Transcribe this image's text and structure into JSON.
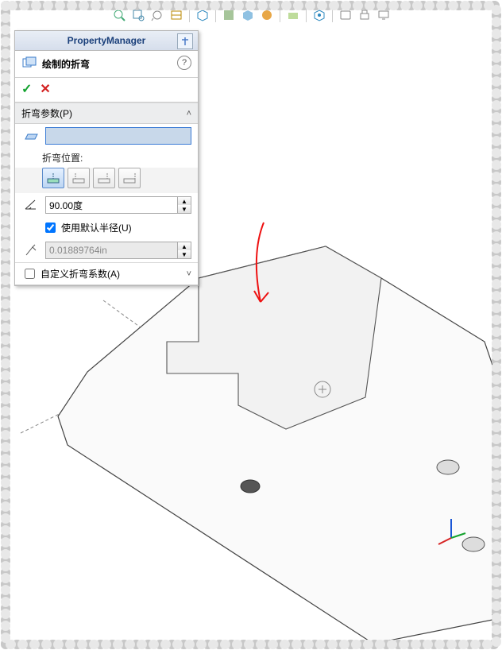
{
  "panel": {
    "title": "PropertyManager",
    "feature": {
      "label": "绘制的折弯",
      "help": "?"
    },
    "confirm_ok": "✓",
    "confirm_cancel": "✕",
    "section_params": {
      "title": "折弯参数(P)"
    },
    "bend_position_label": "折弯位置:",
    "angle": {
      "value": "90.00度"
    },
    "use_default_radius": {
      "label": "使用默认半径(U)",
      "checked": true
    },
    "radius": {
      "value": "0.01889764in"
    },
    "custom_allowance": {
      "label": "自定义折弯系数(A)",
      "checked": false
    }
  }
}
